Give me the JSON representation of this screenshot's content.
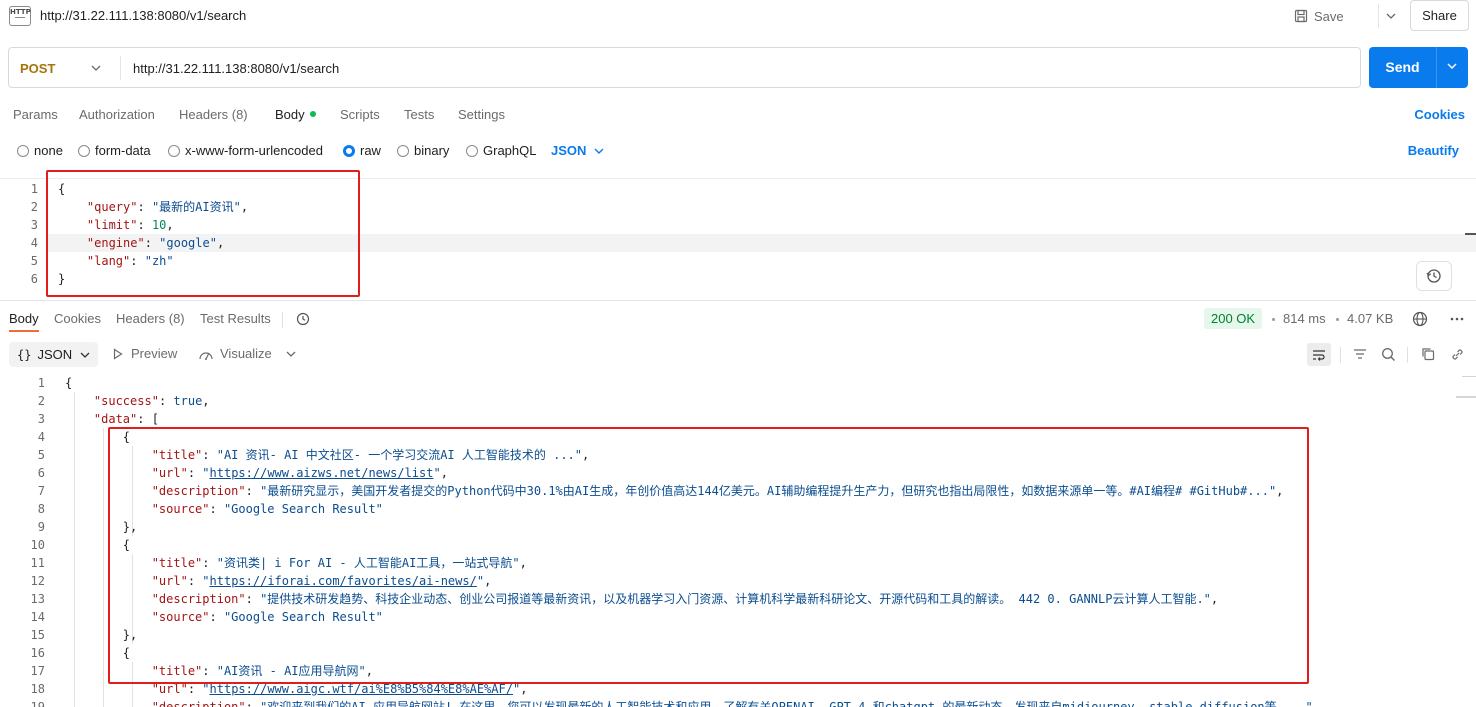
{
  "tab": {
    "title": "http://31.22.111.138:8080/v1/search",
    "icon": "HTTP"
  },
  "top_actions": {
    "save_label": "Save",
    "share_label": "Share"
  },
  "request": {
    "method": "POST",
    "url": "http://31.22.111.138:8080/v1/search",
    "send_label": "Send"
  },
  "request_tabs": [
    {
      "label": "Params"
    },
    {
      "label": "Authorization"
    },
    {
      "label": "Headers (8)"
    },
    {
      "label": "Body",
      "active": true
    },
    {
      "label": "Scripts"
    },
    {
      "label": "Tests"
    },
    {
      "label": "Settings"
    }
  ],
  "cookies_label": "Cookies",
  "body_types": {
    "options": [
      "none",
      "form-data",
      "x-www-form-urlencoded",
      "raw",
      "binary",
      "GraphQL"
    ],
    "selected": "raw",
    "format": "JSON",
    "beautify_label": "Beautify"
  },
  "request_body_lines": [
    {
      "n": "1",
      "t": [
        [
          "p",
          "{"
        ]
      ]
    },
    {
      "n": "2",
      "t": [
        [
          "p",
          "    "
        ],
        [
          "k",
          "\"query\""
        ],
        [
          "p",
          ": "
        ],
        [
          "s",
          "\"最新的AI资讯\""
        ],
        [
          "p",
          ","
        ]
      ]
    },
    {
      "n": "3",
      "t": [
        [
          "p",
          "    "
        ],
        [
          "k",
          "\"limit\""
        ],
        [
          "p",
          ": "
        ],
        [
          "n",
          "10"
        ],
        [
          "p",
          ","
        ]
      ]
    },
    {
      "n": "4",
      "t": [
        [
          "p",
          "    "
        ],
        [
          "k",
          "\"engine\""
        ],
        [
          "p",
          ": "
        ],
        [
          "s",
          "\"google\""
        ],
        [
          "p",
          ","
        ]
      ]
    },
    {
      "n": "5",
      "t": [
        [
          "p",
          "    "
        ],
        [
          "k",
          "\"lang\""
        ],
        [
          "p",
          ": "
        ],
        [
          "s",
          "\"zh\""
        ]
      ]
    },
    {
      "n": "6",
      "t": [
        [
          "p",
          "}"
        ]
      ]
    }
  ],
  "response_tabs": [
    {
      "label": "Body",
      "active": true
    },
    {
      "label": "Cookies"
    },
    {
      "label": "Headers (8)"
    },
    {
      "label": "Test Results"
    }
  ],
  "response_meta": {
    "status": "200 OK",
    "status_color": "#007f31",
    "time": "814 ms",
    "size": "4.07 KB"
  },
  "response_toolbar": {
    "format": "JSON",
    "preview_label": "Preview",
    "visualize_label": "Visualize"
  },
  "response_body_lines": [
    {
      "n": "1",
      "t": [
        [
          "p",
          "{"
        ]
      ]
    },
    {
      "n": "2",
      "t": [
        [
          "p",
          "    "
        ],
        [
          "k",
          "\"success\""
        ],
        [
          "p",
          ": "
        ],
        [
          "b",
          "true"
        ],
        [
          "p",
          ","
        ]
      ]
    },
    {
      "n": "3",
      "t": [
        [
          "p",
          "    "
        ],
        [
          "k",
          "\"data\""
        ],
        [
          "p",
          ": ["
        ]
      ]
    },
    {
      "n": "4",
      "t": [
        [
          "p",
          "        {"
        ]
      ]
    },
    {
      "n": "5",
      "t": [
        [
          "p",
          "            "
        ],
        [
          "k",
          "\"title\""
        ],
        [
          "p",
          ": "
        ],
        [
          "s",
          "\"AI 资讯- AI 中文社区- 一个学习交流AI 人工智能技术的 ...\""
        ],
        [
          "p",
          ","
        ]
      ]
    },
    {
      "n": "6",
      "t": [
        [
          "p",
          "            "
        ],
        [
          "k",
          "\"url\""
        ],
        [
          "p",
          ": "
        ],
        [
          "s",
          "\""
        ],
        [
          "l",
          "https://www.aizws.net/news/list"
        ],
        [
          "s",
          "\""
        ],
        [
          "p",
          ","
        ]
      ]
    },
    {
      "n": "7",
      "t": [
        [
          "p",
          "            "
        ],
        [
          "k",
          "\"description\""
        ],
        [
          "p",
          ": "
        ],
        [
          "s",
          "\"最新研究显示，美国开发者提交的Python代码中30.1%由AI生成，年创价值高达144亿美元。AI辅助编程提升生产力，但研究也指出局限性，如数据来源单一等。#AI编程# #GitHub#...\""
        ],
        [
          "p",
          ","
        ]
      ]
    },
    {
      "n": "8",
      "t": [
        [
          "p",
          "            "
        ],
        [
          "k",
          "\"source\""
        ],
        [
          "p",
          ": "
        ],
        [
          "s",
          "\"Google Search Result\""
        ]
      ]
    },
    {
      "n": "9",
      "t": [
        [
          "p",
          "        },"
        ]
      ]
    },
    {
      "n": "10",
      "t": [
        [
          "p",
          "        {"
        ]
      ]
    },
    {
      "n": "11",
      "t": [
        [
          "p",
          "            "
        ],
        [
          "k",
          "\"title\""
        ],
        [
          "p",
          ": "
        ],
        [
          "s",
          "\"资讯类| i For AI - 人工智能AI工具，一站式导航\""
        ],
        [
          "p",
          ","
        ]
      ]
    },
    {
      "n": "12",
      "t": [
        [
          "p",
          "            "
        ],
        [
          "k",
          "\"url\""
        ],
        [
          "p",
          ": "
        ],
        [
          "s",
          "\""
        ],
        [
          "l",
          "https://iforai.com/favorites/ai-news/"
        ],
        [
          "s",
          "\""
        ],
        [
          "p",
          ","
        ]
      ]
    },
    {
      "n": "13",
      "t": [
        [
          "p",
          "            "
        ],
        [
          "k",
          "\"description\""
        ],
        [
          "p",
          ": "
        ],
        [
          "s",
          "\"提供技术研发趋势、科技企业动态、创业公司报道等最新资讯，以及机器学习入门资源、计算机科学最新科研论文、开源代码和工具的解读。 442 0. GANNLP云计算人工智能.\""
        ],
        [
          "p",
          ","
        ]
      ]
    },
    {
      "n": "14",
      "t": [
        [
          "p",
          "            "
        ],
        [
          "k",
          "\"source\""
        ],
        [
          "p",
          ": "
        ],
        [
          "s",
          "\"Google Search Result\""
        ]
      ]
    },
    {
      "n": "15",
      "t": [
        [
          "p",
          "        },"
        ]
      ]
    },
    {
      "n": "16",
      "t": [
        [
          "p",
          "        {"
        ]
      ]
    },
    {
      "n": "17",
      "t": [
        [
          "p",
          "            "
        ],
        [
          "k",
          "\"title\""
        ],
        [
          "p",
          ": "
        ],
        [
          "s",
          "\"AI资讯 - AI应用导航网\""
        ],
        [
          "p",
          ","
        ]
      ]
    },
    {
      "n": "18",
      "t": [
        [
          "p",
          "            "
        ],
        [
          "k",
          "\"url\""
        ],
        [
          "p",
          ": "
        ],
        [
          "s",
          "\""
        ],
        [
          "l",
          "https://www.aigc.wtf/ai%E8%B5%84%E8%AE%AF/"
        ],
        [
          "s",
          "\""
        ],
        [
          "p",
          ","
        ]
      ]
    },
    {
      "n": "19",
      "t": [
        [
          "p",
          "            "
        ],
        [
          "k",
          "\"description\""
        ],
        [
          "p",
          ": "
        ],
        [
          "s",
          "\"欢迎来到我们的AI 应用导航网站! 在这里，您可以发现最新的人工智能技术和应用，了解有关OPENAI, GPT-4 和chatgpt 的最新动态，发现来自midjourney, stable diffusion等 ...\""
        ]
      ]
    }
  ]
}
